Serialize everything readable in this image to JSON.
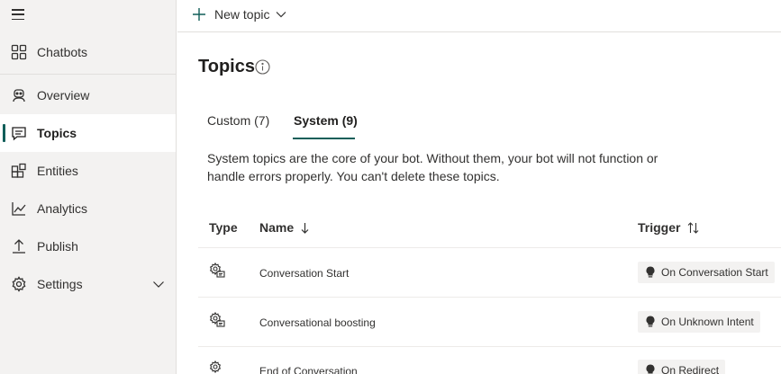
{
  "sidebar": {
    "items": [
      {
        "label": "Chatbots",
        "icon": "grid-icon"
      },
      {
        "label": "Overview",
        "icon": "bot-icon"
      },
      {
        "label": "Topics",
        "icon": "chat-icon",
        "active": true
      },
      {
        "label": "Entities",
        "icon": "entities-icon"
      },
      {
        "label": "Analytics",
        "icon": "chart-icon"
      },
      {
        "label": "Publish",
        "icon": "upload-icon"
      },
      {
        "label": "Settings",
        "icon": "gear-icon"
      }
    ]
  },
  "toolbar": {
    "new_topic_label": "New topic"
  },
  "page": {
    "title": "Topics"
  },
  "tabs": [
    {
      "label": "Custom (7)",
      "selected": false
    },
    {
      "label": "System (9)",
      "selected": true
    }
  ],
  "description": "System topics are the core of your bot. Without them, your bot will not function or handle errors properly. You can't delete these topics.",
  "table": {
    "headers": {
      "type": "Type",
      "name": "Name",
      "trigger": "Trigger"
    },
    "rows": [
      {
        "name": "Conversation Start",
        "trigger": "On Conversation Start"
      },
      {
        "name": "Conversational boosting",
        "trigger": "On Unknown Intent"
      },
      {
        "name": "End of Conversation",
        "trigger": "On Redirect"
      }
    ]
  },
  "colors": {
    "accent": "#115e59",
    "sidebar_bg": "#f3f2f1",
    "chip_bg": "#f3f2f1"
  }
}
